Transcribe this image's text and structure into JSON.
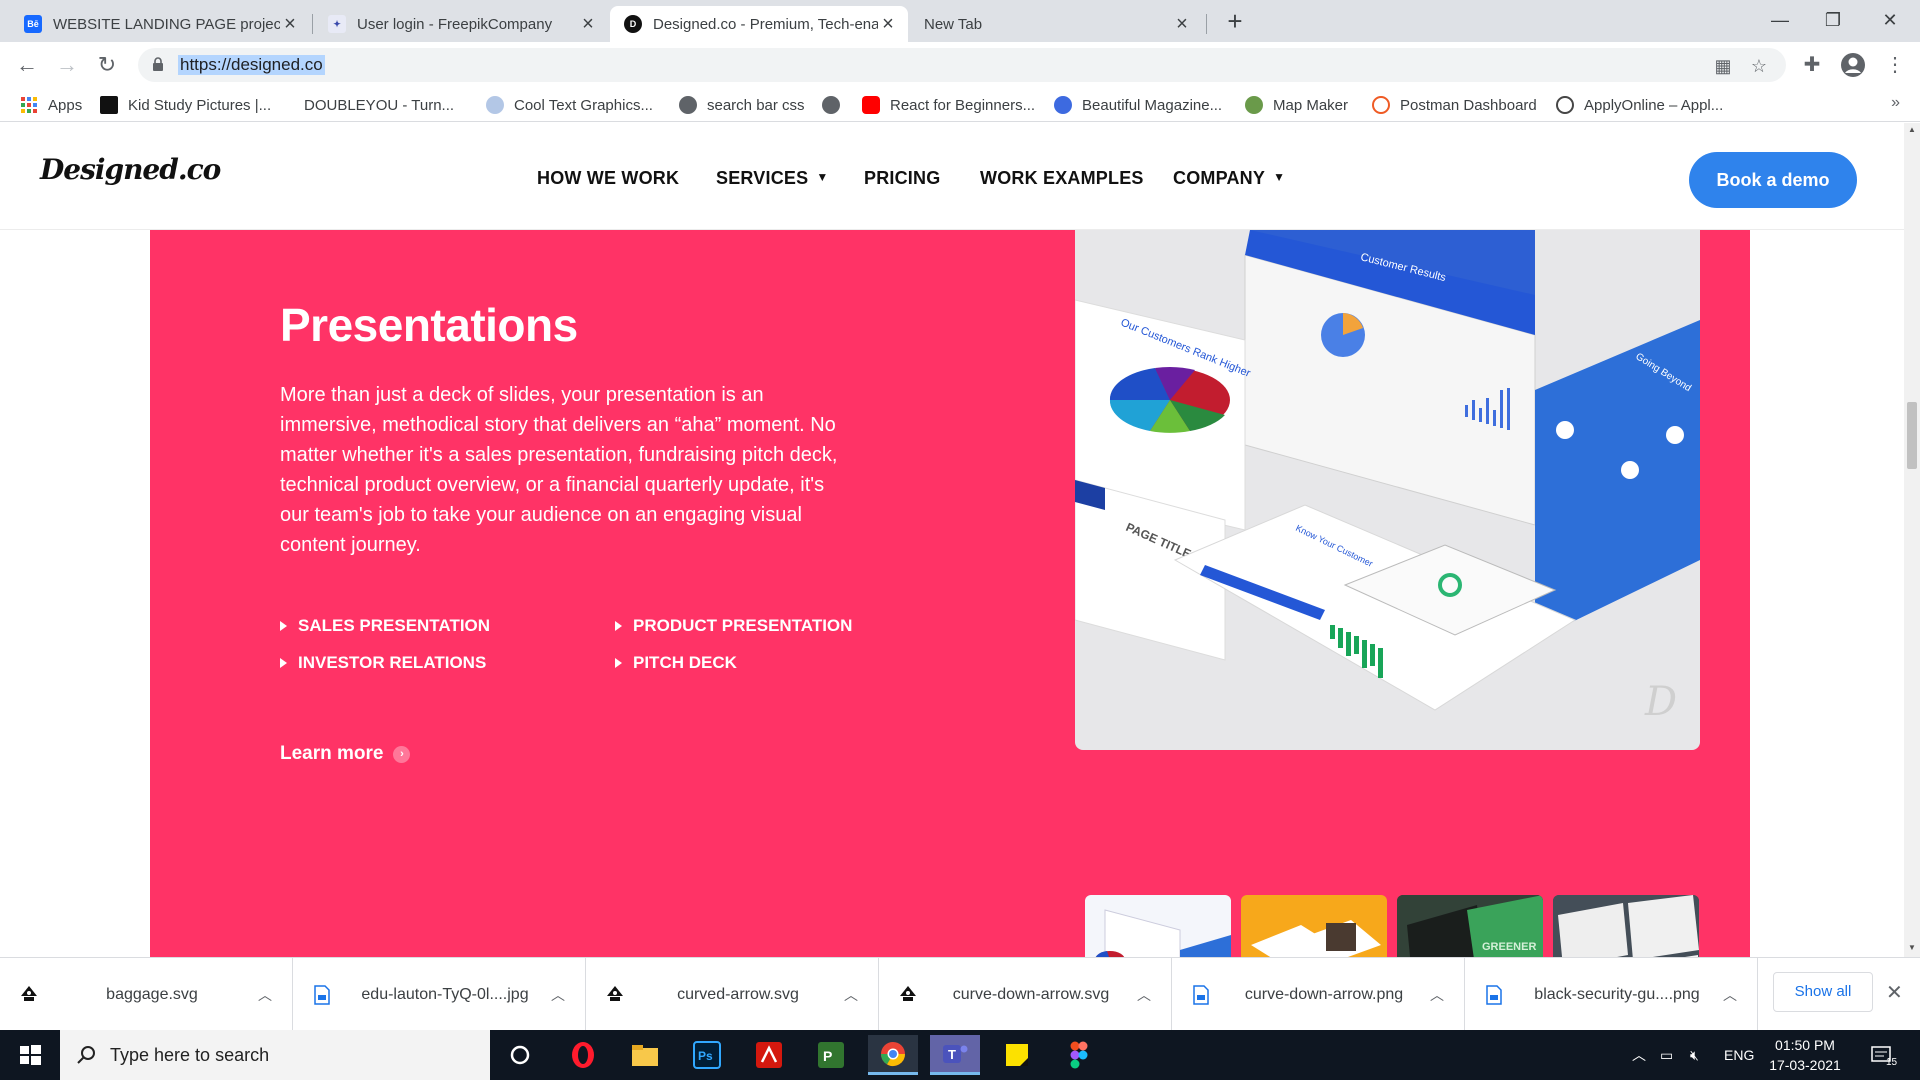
{
  "browser": {
    "tabs": [
      {
        "title": "WEBSITE LANDING PAGE project",
        "icon": "behance-icon",
        "active": false
      },
      {
        "title": "User login - FreepikCompany",
        "icon": "freepik-icon",
        "active": false
      },
      {
        "title": "Designed.co - Premium, Tech-ena",
        "icon": "designed-icon",
        "active": true
      },
      {
        "title": "New Tab",
        "icon": "",
        "active": false
      }
    ],
    "url": "https://designed.co",
    "bookmarks": [
      {
        "label": "Apps",
        "icon": "apps-grid-icon"
      },
      {
        "label": "Kid Study Pictures |...",
        "icon": "kid-study-icon"
      },
      {
        "label": "DOUBLEYOU - Turn...",
        "icon": "doubleyou-icon"
      },
      {
        "label": "Cool Text Graphics...",
        "icon": "cooltext-icon"
      },
      {
        "label": "search bar css",
        "icon": "globe-icon"
      },
      {
        "label": "",
        "icon": "globe-icon"
      },
      {
        "label": "React for Beginners...",
        "icon": "youtube-icon"
      },
      {
        "label": "Beautiful Magazine...",
        "icon": "canva-icon"
      },
      {
        "label": "Map Maker",
        "icon": "map-icon"
      },
      {
        "label": "Postman Dashboard",
        "icon": "postman-icon"
      },
      {
        "label": "ApplyOnline – Appl...",
        "icon": "wordpress-icon"
      }
    ],
    "bookmarks_more": "»"
  },
  "site": {
    "logo": "Designed.co",
    "nav": [
      {
        "label": "HOW WE WORK",
        "dropdown": false
      },
      {
        "label": "SERVICES",
        "dropdown": true
      },
      {
        "label": "PRICING",
        "dropdown": false
      },
      {
        "label": "WORK EXAMPLES",
        "dropdown": false
      },
      {
        "label": "COMPANY",
        "dropdown": true
      }
    ],
    "cta": "Book a demo",
    "hero": {
      "title": "Presentations",
      "body": "More than just a deck of slides, your presentation is an immersive, methodical story that delivers an “aha” moment. No matter whether it's a sales presentation, fundraising pitch deck, technical product overview, or a financial quarterly update, it's our team's job to take your audience on an engaging visual content journey.",
      "features": [
        "SALES PRESENTATION",
        "PRODUCT PRESENTATION",
        "INVESTOR RELATIONS",
        "PITCH DECK"
      ],
      "learn_more": "Learn more",
      "mockup_texts": {
        "slide_a_title": "Our Customers Rank Higher",
        "slide_b_title": "Customer Results",
        "slide_c_title": "PAGE TITLE",
        "slide_d_title": "Know Your Customer",
        "slide_e_title": "Going Beyond"
      }
    },
    "colors": {
      "accent": "#ff3366",
      "cta_blue": "#2f83ec"
    }
  },
  "downloads": {
    "items": [
      {
        "name": "baggage.svg",
        "icon": "inkscape-icon"
      },
      {
        "name": "edu-lauton-TyQ-0l....jpg",
        "icon": "file-icon"
      },
      {
        "name": "curved-arrow.svg",
        "icon": "inkscape-icon"
      },
      {
        "name": "curve-down-arrow.svg",
        "icon": "inkscape-icon"
      },
      {
        "name": "curve-down-arrow.png",
        "icon": "file-icon"
      },
      {
        "name": "black-security-gu....png",
        "icon": "file-icon"
      }
    ],
    "show_all": "Show all"
  },
  "taskbar": {
    "search_placeholder": "Type here to search",
    "apps": [
      "cortana-icon",
      "opera-icon",
      "file-explorer-icon",
      "photoshop-icon",
      "acrobat-icon",
      "project-icon",
      "chrome-icon",
      "teams-icon",
      "sticky-notes-icon",
      "figma-icon"
    ],
    "language": "ENG",
    "time": "01:50 PM",
    "date": "17-03-2021",
    "notifications": "15"
  }
}
